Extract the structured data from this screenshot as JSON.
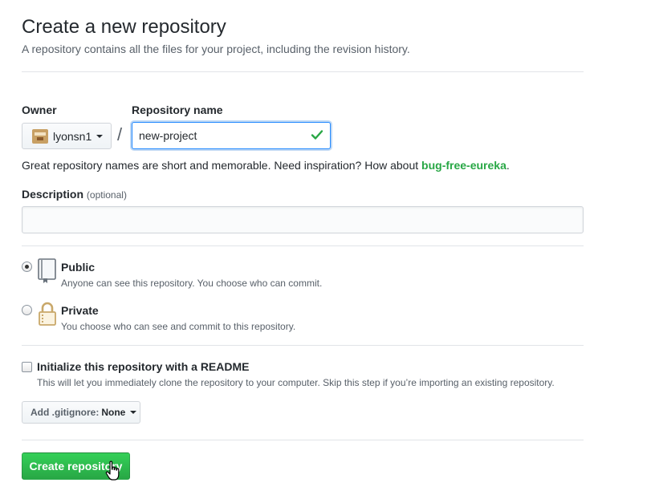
{
  "header": {
    "title": "Create a new repository",
    "subtitle": "A repository contains all the files for your project, including the revision history."
  },
  "owner": {
    "label": "Owner",
    "value": "lyonsn1",
    "avatar_icon": "user-avatar"
  },
  "separator": "/",
  "repo_name": {
    "label": "Repository name",
    "value": "new-project",
    "valid_icon": "check-icon",
    "valid_color": "#28a745"
  },
  "hint": {
    "text": "Great repository names are short and memorable. Need inspiration? How about ",
    "suggestion": "bug-free-eureka",
    "end": "."
  },
  "description": {
    "label": "Description",
    "optional": "(optional)",
    "value": "",
    "placeholder": ""
  },
  "visibility": {
    "selected": "public",
    "public": {
      "title": "Public",
      "note": "Anyone can see this repository. You choose who can commit.",
      "icon": "repo-book-icon"
    },
    "private": {
      "title": "Private",
      "note": "You choose who can see and commit to this repository.",
      "icon": "lock-icon"
    }
  },
  "readme": {
    "title": "Initialize this repository with a README",
    "note": "This will let you immediately clone the repository to your computer. Skip this step if you’re importing an existing repository.",
    "checked": false
  },
  "gitignore": {
    "prefix": "Add .gitignore:",
    "value": "None"
  },
  "submit": {
    "label": "Create repository",
    "color": "#28a745"
  },
  "cursor_icon": "hand-pointer-icon"
}
